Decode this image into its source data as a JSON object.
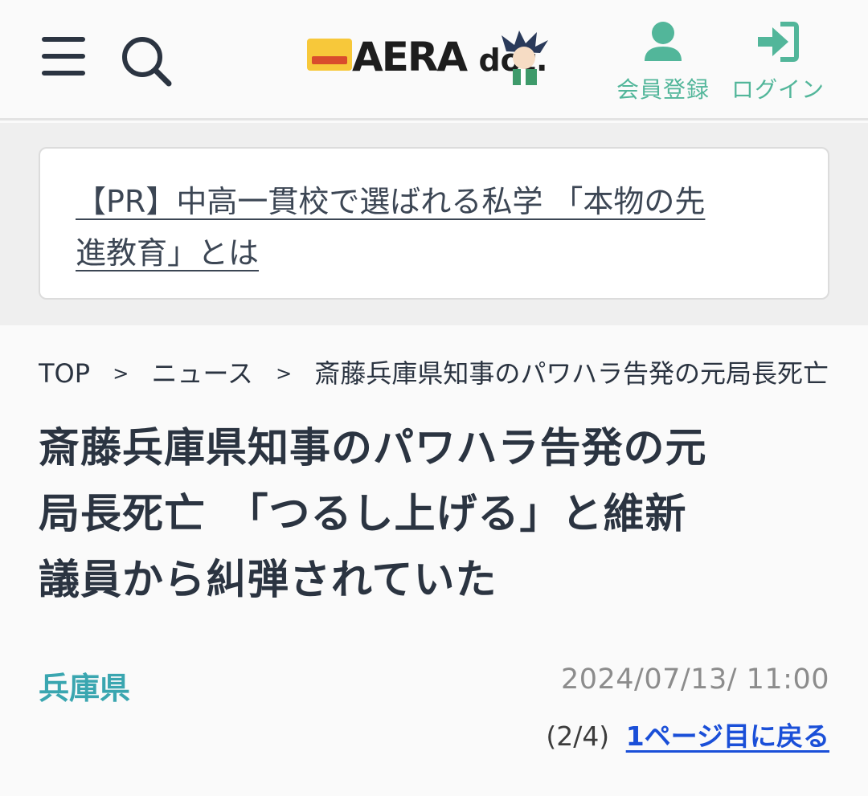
{
  "header": {
    "logo_text": "AERA",
    "logo_text_suffix": "dot.",
    "member_label": "会員登録",
    "login_label": "ログイン",
    "accent_color": "#52b69a"
  },
  "pr": {
    "line1": "【PR】中高一貫校で選ばれる私学 「本物の先",
    "line2": "進教育」とは"
  },
  "breadcrumb": {
    "items": [
      "TOP",
      "ニュース",
      "斎藤兵庫県知事のパワハラ告発の元局長死亡"
    ],
    "separator": ">"
  },
  "article": {
    "title_line1": "斎藤兵庫県知事のパワハラ告発の元",
    "title_line2": "局長死亡　「つるし上げる」と維新",
    "title_line3": "議員から糾弾されていた",
    "category": "兵庫県",
    "date": "2024/07/13/ 11:00",
    "page_indicator": "(2/4)",
    "back_link": "1ページ目に戻る"
  }
}
